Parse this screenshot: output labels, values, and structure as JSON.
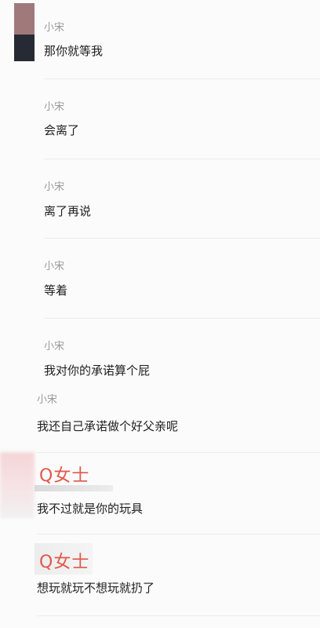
{
  "messages": [
    {
      "sender": "小宋",
      "text": "那你就等我"
    },
    {
      "sender": "小宋",
      "text": "会离了"
    },
    {
      "sender": "小宋",
      "text": "离了再说"
    },
    {
      "sender": "小宋",
      "text": "等着"
    },
    {
      "sender": "小宋",
      "text": "我对你的承诺算个屁"
    },
    {
      "sender": "小宋",
      "text": "我还自己承诺做个好父亲呢"
    },
    {
      "sender": "Q女士",
      "text": "我不过就是你的玩具"
    },
    {
      "sender": "Q女士",
      "text": "想玩就玩不想玩就扔了"
    }
  ],
  "colors": {
    "sender_gray": "#9a9a9a",
    "sender_red": "#e0584a",
    "text": "#1f1f1f",
    "divider": "#ececec"
  }
}
